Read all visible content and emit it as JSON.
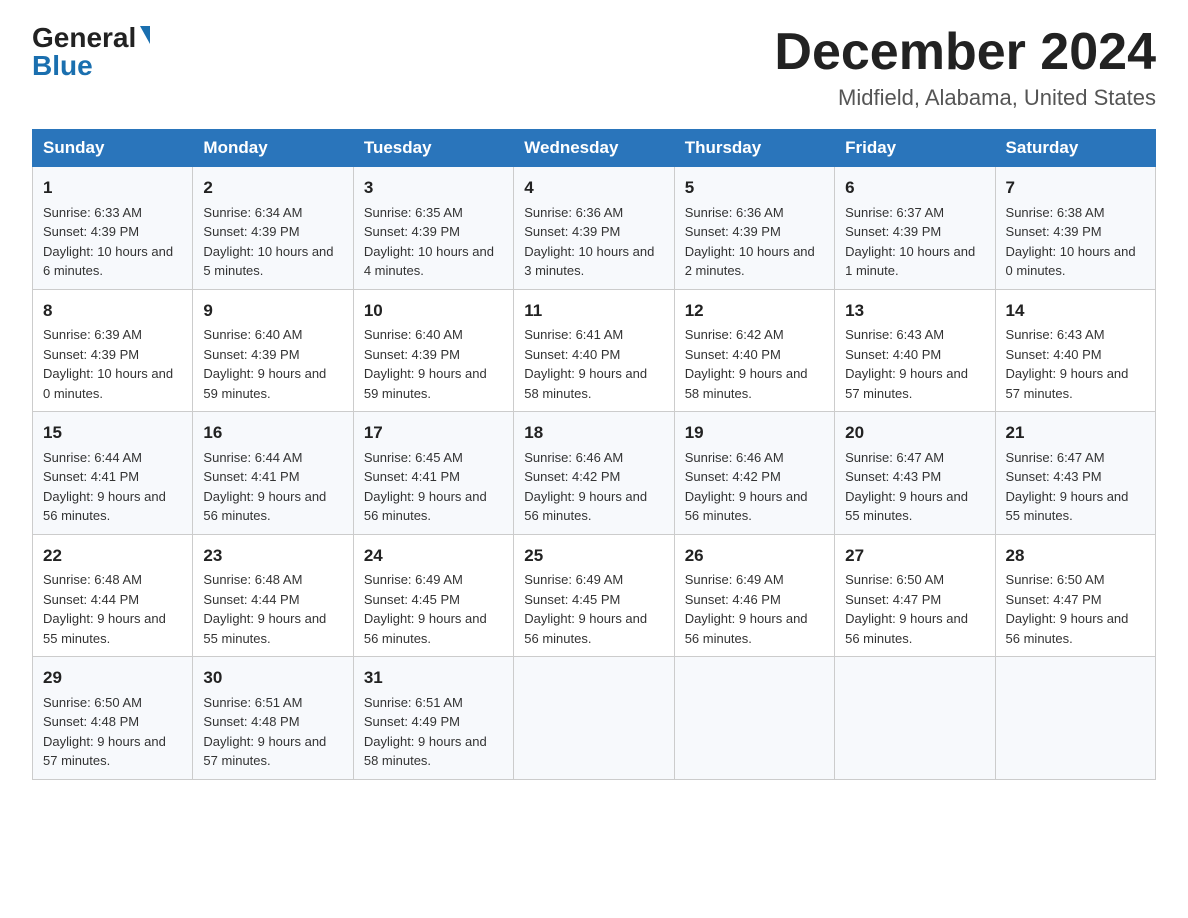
{
  "header": {
    "logo_general": "General",
    "logo_blue": "Blue",
    "month_year": "December 2024",
    "location": "Midfield, Alabama, United States"
  },
  "days_of_week": [
    "Sunday",
    "Monday",
    "Tuesday",
    "Wednesday",
    "Thursday",
    "Friday",
    "Saturday"
  ],
  "weeks": [
    [
      {
        "day": "1",
        "sunrise": "6:33 AM",
        "sunset": "4:39 PM",
        "daylight": "10 hours and 6 minutes."
      },
      {
        "day": "2",
        "sunrise": "6:34 AM",
        "sunset": "4:39 PM",
        "daylight": "10 hours and 5 minutes."
      },
      {
        "day": "3",
        "sunrise": "6:35 AM",
        "sunset": "4:39 PM",
        "daylight": "10 hours and 4 minutes."
      },
      {
        "day": "4",
        "sunrise": "6:36 AM",
        "sunset": "4:39 PM",
        "daylight": "10 hours and 3 minutes."
      },
      {
        "day": "5",
        "sunrise": "6:36 AM",
        "sunset": "4:39 PM",
        "daylight": "10 hours and 2 minutes."
      },
      {
        "day": "6",
        "sunrise": "6:37 AM",
        "sunset": "4:39 PM",
        "daylight": "10 hours and 1 minute."
      },
      {
        "day": "7",
        "sunrise": "6:38 AM",
        "sunset": "4:39 PM",
        "daylight": "10 hours and 0 minutes."
      }
    ],
    [
      {
        "day": "8",
        "sunrise": "6:39 AM",
        "sunset": "4:39 PM",
        "daylight": "10 hours and 0 minutes."
      },
      {
        "day": "9",
        "sunrise": "6:40 AM",
        "sunset": "4:39 PM",
        "daylight": "9 hours and 59 minutes."
      },
      {
        "day": "10",
        "sunrise": "6:40 AM",
        "sunset": "4:39 PM",
        "daylight": "9 hours and 59 minutes."
      },
      {
        "day": "11",
        "sunrise": "6:41 AM",
        "sunset": "4:40 PM",
        "daylight": "9 hours and 58 minutes."
      },
      {
        "day": "12",
        "sunrise": "6:42 AM",
        "sunset": "4:40 PM",
        "daylight": "9 hours and 58 minutes."
      },
      {
        "day": "13",
        "sunrise": "6:43 AM",
        "sunset": "4:40 PM",
        "daylight": "9 hours and 57 minutes."
      },
      {
        "day": "14",
        "sunrise": "6:43 AM",
        "sunset": "4:40 PM",
        "daylight": "9 hours and 57 minutes."
      }
    ],
    [
      {
        "day": "15",
        "sunrise": "6:44 AM",
        "sunset": "4:41 PM",
        "daylight": "9 hours and 56 minutes."
      },
      {
        "day": "16",
        "sunrise": "6:44 AM",
        "sunset": "4:41 PM",
        "daylight": "9 hours and 56 minutes."
      },
      {
        "day": "17",
        "sunrise": "6:45 AM",
        "sunset": "4:41 PM",
        "daylight": "9 hours and 56 minutes."
      },
      {
        "day": "18",
        "sunrise": "6:46 AM",
        "sunset": "4:42 PM",
        "daylight": "9 hours and 56 minutes."
      },
      {
        "day": "19",
        "sunrise": "6:46 AM",
        "sunset": "4:42 PM",
        "daylight": "9 hours and 56 minutes."
      },
      {
        "day": "20",
        "sunrise": "6:47 AM",
        "sunset": "4:43 PM",
        "daylight": "9 hours and 55 minutes."
      },
      {
        "day": "21",
        "sunrise": "6:47 AM",
        "sunset": "4:43 PM",
        "daylight": "9 hours and 55 minutes."
      }
    ],
    [
      {
        "day": "22",
        "sunrise": "6:48 AM",
        "sunset": "4:44 PM",
        "daylight": "9 hours and 55 minutes."
      },
      {
        "day": "23",
        "sunrise": "6:48 AM",
        "sunset": "4:44 PM",
        "daylight": "9 hours and 55 minutes."
      },
      {
        "day": "24",
        "sunrise": "6:49 AM",
        "sunset": "4:45 PM",
        "daylight": "9 hours and 56 minutes."
      },
      {
        "day": "25",
        "sunrise": "6:49 AM",
        "sunset": "4:45 PM",
        "daylight": "9 hours and 56 minutes."
      },
      {
        "day": "26",
        "sunrise": "6:49 AM",
        "sunset": "4:46 PM",
        "daylight": "9 hours and 56 minutes."
      },
      {
        "day": "27",
        "sunrise": "6:50 AM",
        "sunset": "4:47 PM",
        "daylight": "9 hours and 56 minutes."
      },
      {
        "day": "28",
        "sunrise": "6:50 AM",
        "sunset": "4:47 PM",
        "daylight": "9 hours and 56 minutes."
      }
    ],
    [
      {
        "day": "29",
        "sunrise": "6:50 AM",
        "sunset": "4:48 PM",
        "daylight": "9 hours and 57 minutes."
      },
      {
        "day": "30",
        "sunrise": "6:51 AM",
        "sunset": "4:48 PM",
        "daylight": "9 hours and 57 minutes."
      },
      {
        "day": "31",
        "sunrise": "6:51 AM",
        "sunset": "4:49 PM",
        "daylight": "9 hours and 58 minutes."
      },
      null,
      null,
      null,
      null
    ]
  ],
  "labels": {
    "sunrise": "Sunrise:",
    "sunset": "Sunset:",
    "daylight": "Daylight:"
  }
}
